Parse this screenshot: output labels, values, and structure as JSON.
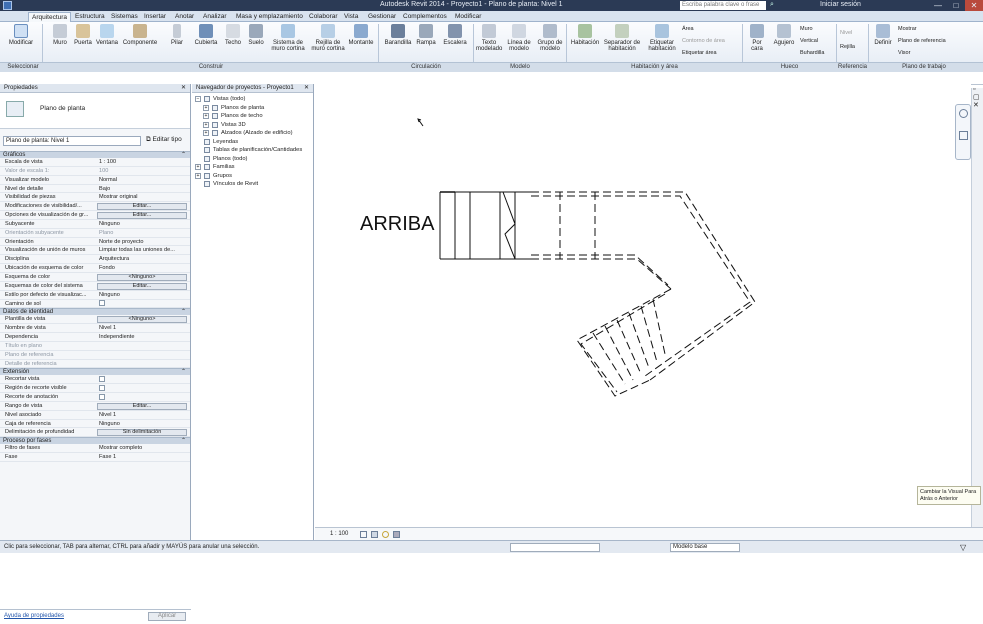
{
  "titlebar": {
    "title": "Autodesk Revit 2014 - Proyecto1 - Plano de planta: Nivel 1",
    "search_placeholder": "Escriba palabra clave o frase",
    "user": "Iniciar sesión",
    "controls": [
      "—",
      "□",
      "✕"
    ]
  },
  "ribbon_tabs": [
    "Arquitectura",
    "Estructura",
    "Sistemas",
    "Insertar",
    "Anotar",
    "Analizar",
    "Masa y emplazamiento",
    "Colaborar",
    "Vista",
    "Gestionar",
    "Complementos",
    "Modificar"
  ],
  "ribbon_buttons": {
    "modify": "Modificar",
    "construct": [
      "Muro",
      "Puerta",
      "Ventana",
      "Componente",
      "Pilar",
      "Cubierta",
      "Techo",
      "Suelo",
      "Sistema de muro cortina",
      "Rejilla de muro cortina",
      "Montante"
    ],
    "circulation": [
      "Barandilla",
      "Rampa",
      "Escalera"
    ],
    "model": [
      "Texto modelado",
      "Línea de modelo",
      "Grupo de modelo"
    ],
    "room_area": [
      "Habitación",
      "Separador de habitación",
      "Etiquetar habitación",
      "Área",
      "Contorno de área",
      "Etiquetar área"
    ],
    "opening": [
      "Por cara",
      "Agujero",
      "Muro",
      "Vertical",
      "Buhardilla"
    ],
    "datum": [
      "Nivel",
      "Rejilla"
    ],
    "workplane": [
      "Definir",
      "Mostrar",
      "Plano de referencia",
      "Visor"
    ]
  },
  "ribbon_panels": [
    "Seleccionar",
    "Construir",
    "Circulación",
    "Modelo",
    "Habitación y área",
    "Hueco",
    "Referencia",
    "Plano de trabajo"
  ],
  "properties": {
    "header": "Propiedades",
    "type_name": "Plano de planta",
    "filter_value": "Plano de planta: Nivel 1",
    "edit_type": "Editar tipo",
    "groups": [
      {
        "name": "Gráficos",
        "rows": [
          {
            "k": "Escala de vista",
            "v": "1 : 100"
          },
          {
            "k": "Valor de escala    1:",
            "v": "100",
            "dim": true
          },
          {
            "k": "Visualizar modelo",
            "v": "Normal"
          },
          {
            "k": "Nivel de detalle",
            "v": "Bajo"
          },
          {
            "k": "Visibilidad de piezas",
            "v": "Mostrar original"
          },
          {
            "k": "Modificaciones de visibilidad/...",
            "edit": "Editar..."
          },
          {
            "k": "Opciones de visualización de gr...",
            "edit": "Editar..."
          },
          {
            "k": "Subyacente",
            "v": "Ninguno"
          },
          {
            "k": "Orientación subyacente",
            "v": "Plano",
            "dim": true
          },
          {
            "k": "Orientación",
            "v": "Norte de proyecto"
          },
          {
            "k": "Visualización de unión de muros",
            "v": "Limpiar todas las uniones de..."
          },
          {
            "k": "Disciplina",
            "v": "Arquitectura"
          },
          {
            "k": "Ubicación de esquema de color",
            "v": "Fondo"
          },
          {
            "k": "Esquema de color",
            "edit": "<Ninguno>"
          },
          {
            "k": "Esquemas de color del sistema",
            "edit": "Editar..."
          },
          {
            "k": "Estilo por defecto de visualizac...",
            "v": "Ninguno"
          },
          {
            "k": "Camino de sol",
            "check": true
          }
        ]
      },
      {
        "name": "Datos de identidad",
        "rows": [
          {
            "k": "Plantilla de vista",
            "edit": "<Ninguno>"
          },
          {
            "k": "Nombre de vista",
            "v": "Nivel 1"
          },
          {
            "k": "Dependencia",
            "v": "Independiente"
          },
          {
            "k": "Título en plano",
            "v": "",
            "dim": true
          },
          {
            "k": "Plano de referencia",
            "v": "",
            "dim": true
          },
          {
            "k": "Detalle de referencia",
            "v": "",
            "dim": true
          }
        ]
      },
      {
        "name": "Extensión",
        "rows": [
          {
            "k": "Recortar vista",
            "check": true
          },
          {
            "k": "Región de recorte visible",
            "check": true
          },
          {
            "k": "Recorte de anotación",
            "check": true
          },
          {
            "k": "Rango de vista",
            "edit": "Editar..."
          },
          {
            "k": "Nivel asociado",
            "v": "Nivel 1"
          },
          {
            "k": "Caja de referencia",
            "v": "Ninguno"
          },
          {
            "k": "Delimitación de profundidad",
            "edit": "Sin delimitación"
          }
        ]
      },
      {
        "name": "Proceso por fases",
        "rows": [
          {
            "k": "Filtro de fases",
            "v": "Mostrar completo"
          },
          {
            "k": "Fase",
            "v": "Fase 1"
          }
        ]
      }
    ],
    "help_link": "Ayuda de propiedades",
    "apply": "Aplicar"
  },
  "browser": {
    "header": "Navegador de proyectos - Proyecto1",
    "items": [
      {
        "label": "Vistas (todo)",
        "level": 0,
        "pm": "−"
      },
      {
        "label": "Planos de planta",
        "level": 1,
        "pm": "+"
      },
      {
        "label": "Planos de techo",
        "level": 1,
        "pm": "+"
      },
      {
        "label": "Vistas 3D",
        "level": 1,
        "pm": "+"
      },
      {
        "label": "Alzados (Alzado de edificio)",
        "level": 1,
        "pm": "+"
      },
      {
        "label": "Leyendas",
        "level": 0,
        "pm": ""
      },
      {
        "label": "Tablas de planificación/Cantidades",
        "level": 0,
        "pm": ""
      },
      {
        "label": "Planos (todo)",
        "level": 0,
        "pm": ""
      },
      {
        "label": "Familias",
        "level": 0,
        "pm": "+"
      },
      {
        "label": "Grupos",
        "level": 0,
        "pm": "+"
      },
      {
        "label": "Vínculos de Revit",
        "level": 0,
        "pm": ""
      }
    ]
  },
  "canvas": {
    "stair_label": "ARRIBA"
  },
  "viewbar": {
    "scale": "1 : 100"
  },
  "statusbar": {
    "message": "Clic para seleccionar, TAB para alternar, CTRL para añadir y MAYÚS para anular una selección.",
    "model": "Modelo base"
  },
  "tooltip": "Cambiar la Visual Para Atrás o Anterior",
  "colors": {
    "titlebar": "#2b3a55",
    "ribbon": "#e4ebf4",
    "link": "#2255aa"
  }
}
